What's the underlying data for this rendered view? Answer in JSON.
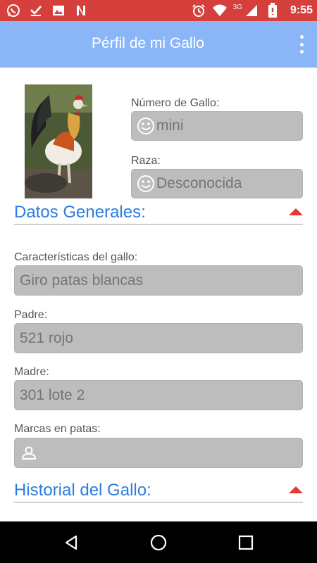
{
  "status_bar": {
    "time": "9:55",
    "network_label": "3G",
    "left_icons": [
      "whatsapp-icon",
      "download-done-icon",
      "image-icon",
      "netflix-icon"
    ],
    "right_icons": [
      "alarm-icon",
      "wifi-icon",
      "signal-icon",
      "battery-icon"
    ]
  },
  "app_bar": {
    "title": "Pérfil de mi Gallo",
    "menu_icon": "overflow-menu-icon"
  },
  "profile": {
    "photo_alt": "rooster-photo",
    "number": {
      "label": "Número de Gallo:",
      "value": "mini",
      "icon": "smiley-icon"
    },
    "breed": {
      "label": "Raza:",
      "value": "Desconocida",
      "icon": "smiley-icon"
    }
  },
  "sections": {
    "general": {
      "title": "Datos Generales:",
      "toggle_icon": "collapse-triangle-icon"
    },
    "history": {
      "title": "Historial del Gallo:",
      "toggle_icon": "collapse-triangle-icon"
    }
  },
  "fields": {
    "characteristics": {
      "label": "Características del gallo:",
      "value": "Giro patas blancas"
    },
    "father": {
      "label": "Padre:",
      "value": "521 rojo"
    },
    "mother": {
      "label": "Madre:",
      "value": "301 lote 2"
    },
    "leg_marks": {
      "label": "Marcas en patas:",
      "value": "",
      "icon": "person-icon"
    }
  },
  "nav_bar": {
    "back_icon": "back-triangle-icon",
    "home_icon": "home-circle-icon",
    "recents_icon": "recents-square-icon"
  },
  "colors": {
    "status_bar": "#d6403c",
    "app_bar": "#8ab5f7",
    "section_title": "#2a7de1",
    "accent_triangle": "#e53935",
    "field_bg": "#bdbdbd"
  }
}
